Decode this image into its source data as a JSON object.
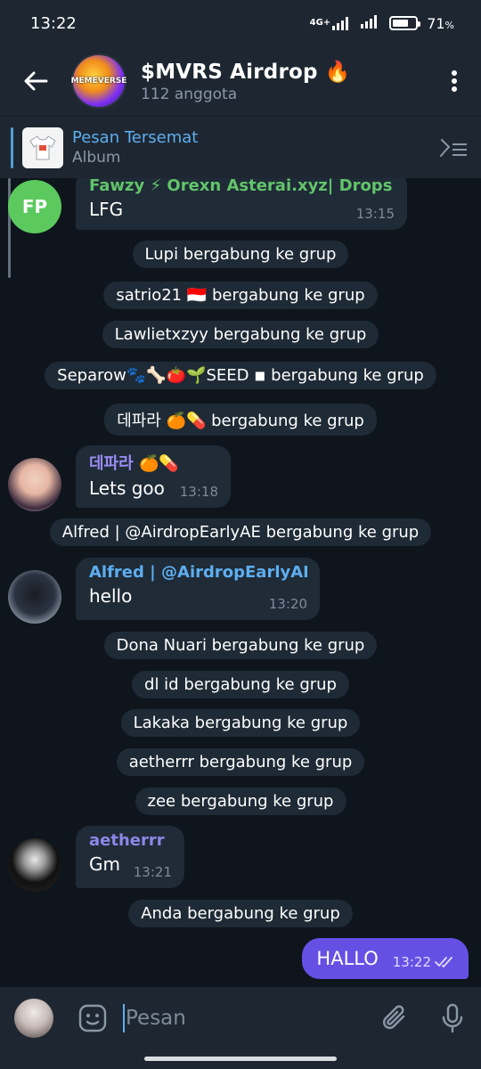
{
  "status": {
    "time": "13:22",
    "network": "4G+",
    "battery": "71",
    "battery_pct_symbol": "%"
  },
  "header": {
    "title": "$MVRS Airdrop 🔥",
    "subtitle": "112 anggota",
    "avatar_text": "MEMEVERSE"
  },
  "pinned": {
    "title": "Pesan Tersemat",
    "subtitle": "Album"
  },
  "messages": [
    {
      "sender": "Fawzy ⚡ Orexn Asterai.xyz| Drops💧...",
      "text": "LFG",
      "time": "13:15",
      "avatar_initials": "FP",
      "sender_color": "#62c46a"
    },
    {
      "sender": "데파라 🍊💊",
      "text": "Lets goo",
      "time": "13:18",
      "sender_color": "#9a8cf2"
    },
    {
      "sender": "Alfred | @AirdropEarlyAE",
      "text": "hello",
      "time": "13:20",
      "sender_color": "#5eaef0"
    },
    {
      "sender": "aetherrr",
      "text": "Gm",
      "time": "13:21",
      "sender_color": "#8d86e8"
    }
  ],
  "service_messages": [
    "Lupi bergabung ke grup",
    "satrio21 🇮🇩 bergabung ke grup",
    "Lawlietxzyy bergabung ke grup",
    "Separow🐾🦴🍅🌱SEED ◾ bergabung ke grup",
    "데파라 🍊💊 bergabung ke grup",
    "Alfred | @AirdropEarlyAE bergabung ke grup",
    "Dona Nuari bergabung ke grup",
    "dl id bergabung ke grup",
    "Lakaka bergabung ke grup",
    "aetherrr bergabung ke grup",
    "zee bergabung ke grup",
    "Anda bergabung ke grup"
  ],
  "outgoing": {
    "text": "HALLO",
    "time": "13:22"
  },
  "input": {
    "placeholder": "Pesan"
  },
  "colors": {
    "outgoing_bubble": "#6650e4",
    "incoming_bubble": "#1f2b37",
    "link_blue": "#5eaef0"
  }
}
